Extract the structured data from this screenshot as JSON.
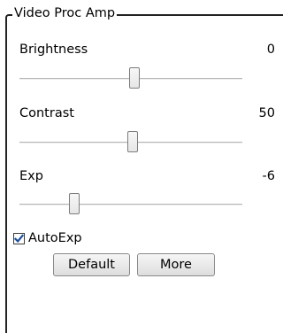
{
  "group": {
    "title": "Video Proc Amp"
  },
  "controls": [
    {
      "label": "Brightness",
      "value": "0",
      "slider_position": 0.52
    },
    {
      "label": "Contrast",
      "value": "50",
      "slider_position": 0.51
    },
    {
      "label": "Exp",
      "value": "-6",
      "slider_position": 0.25
    }
  ],
  "auto_exp": {
    "label": "AutoExp",
    "checked": true
  },
  "buttons": {
    "default_label": "Default",
    "more_label": "More"
  },
  "colors": {
    "check_mark": "#1a4fa0"
  }
}
